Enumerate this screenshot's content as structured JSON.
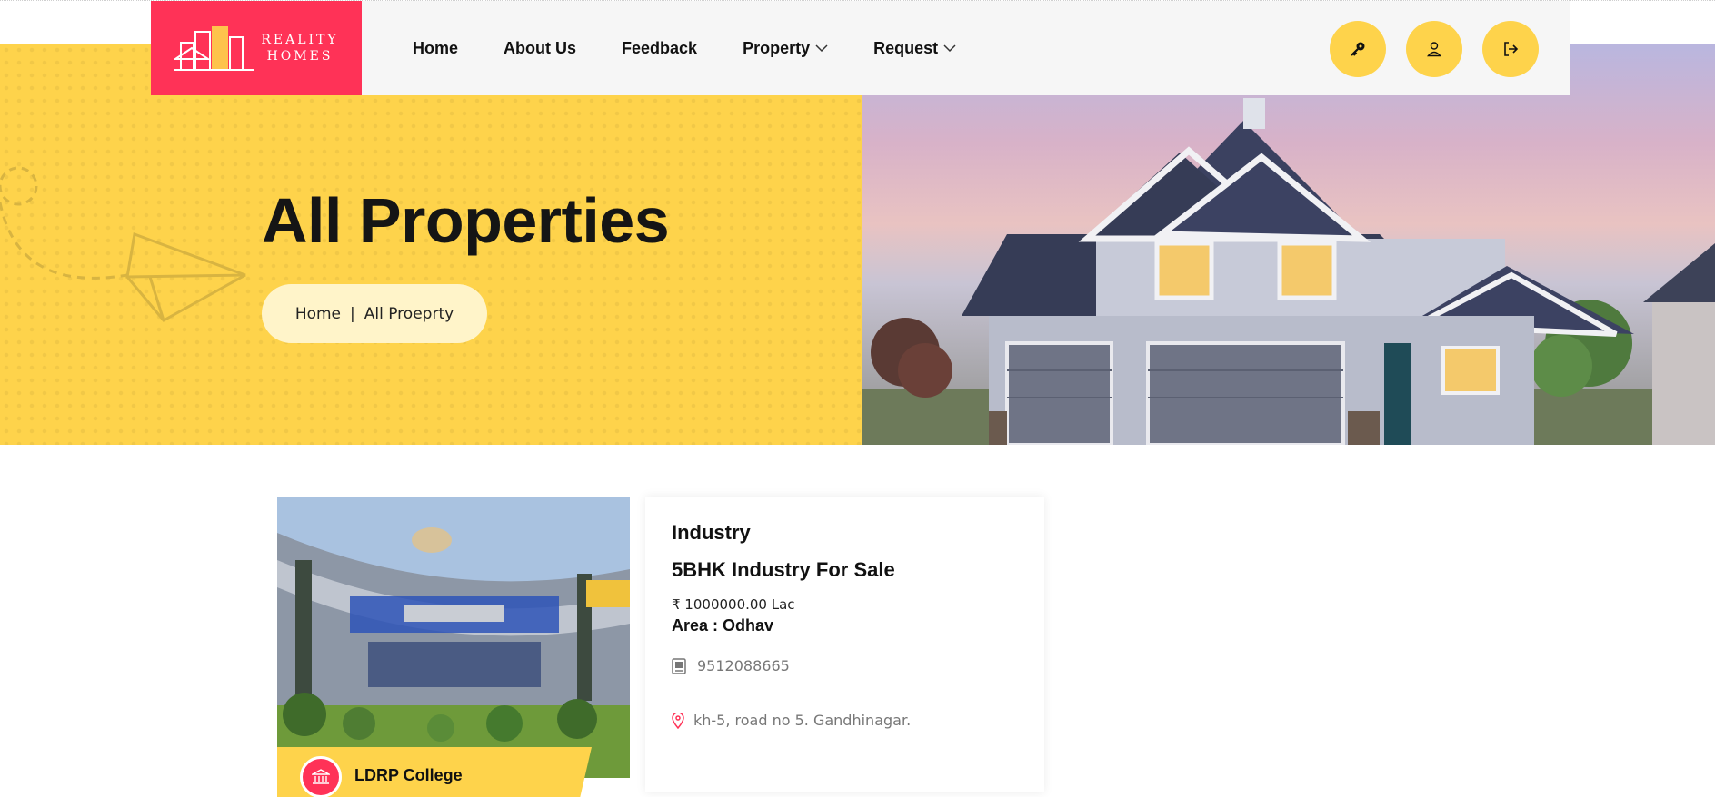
{
  "brand": {
    "line1": "REALITY",
    "line2": "HOMES"
  },
  "nav": [
    {
      "label": "Home"
    },
    {
      "label": "About Us"
    },
    {
      "label": "Feedback"
    },
    {
      "label": "Property",
      "dropdown": true
    },
    {
      "label": "Request",
      "dropdown": true
    }
  ],
  "header_buttons": [
    {
      "icon": "key-icon"
    },
    {
      "icon": "user-icon"
    },
    {
      "icon": "logout-icon"
    }
  ],
  "hero": {
    "title": "All Properties",
    "breadcrumb": {
      "home": "Home",
      "separator": "|",
      "current": "All Proeprty"
    }
  },
  "listing": {
    "tag_label": "LDRP College",
    "category": "Industry",
    "title": "5BHK Industry For Sale",
    "price": "₹ 1000000.00 Lac",
    "area": "Area : Odhav",
    "phone": "9512088665",
    "address": "kh-5, road no 5. Gandhinagar."
  },
  "colors": {
    "accent": "#fed34b",
    "brand": "#ff3257",
    "text": "#111111",
    "muted": "#777777"
  }
}
